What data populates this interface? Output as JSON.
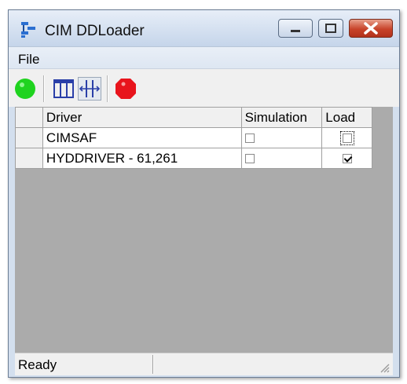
{
  "window": {
    "title": "CIM DDLoader"
  },
  "menu": {
    "file": "File"
  },
  "toolbar": {
    "icons": [
      "green-circle-start-icon",
      "columns-icon",
      "column-resize-icon",
      "red-stop-icon"
    ],
    "colors": {
      "start": "#1fd31f",
      "stop": "#e8141c"
    }
  },
  "grid": {
    "headers": {
      "driver": "Driver",
      "simulation": "Simulation",
      "load": "Load"
    },
    "rows": [
      {
        "driver": "CIMSAF",
        "simulation": false,
        "load": false
      },
      {
        "driver": "HYDDRIVER -  61,261",
        "simulation": false,
        "load": true
      }
    ]
  },
  "status": {
    "text": "Ready"
  }
}
